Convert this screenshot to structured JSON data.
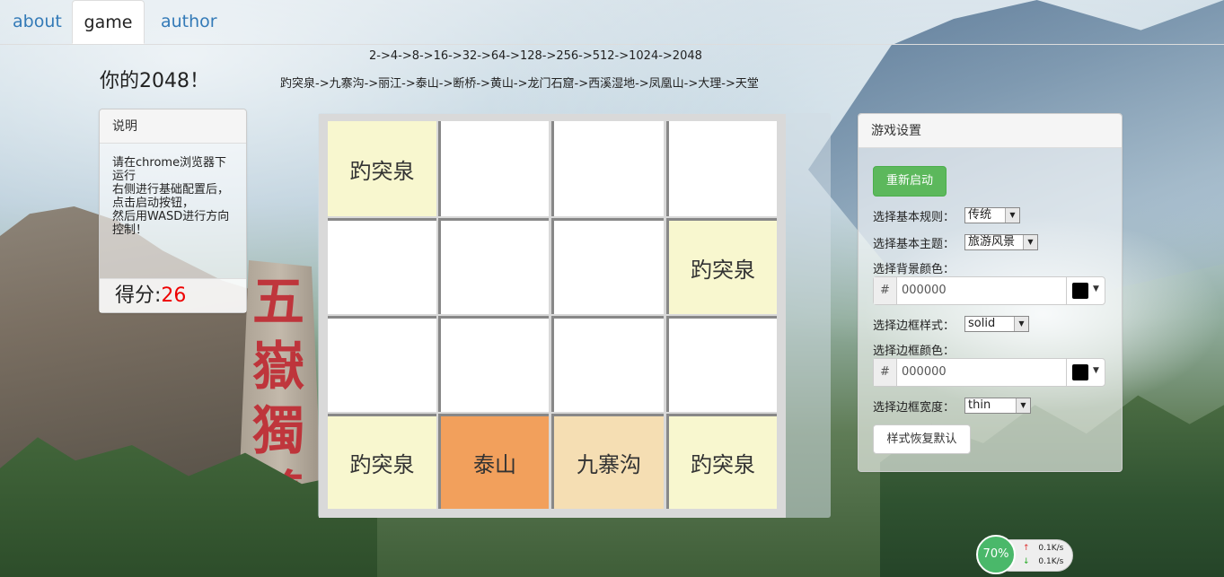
{
  "nav": {
    "tabs": [
      {
        "label": "about"
      },
      {
        "label": "game"
      },
      {
        "label": "author"
      }
    ]
  },
  "header": {
    "title": "你的2048！",
    "sequence_numbers": "2->4->8->16->32->64->128->256->512->1024->2048",
    "sequence_places": "趵突泉->九寨沟->丽江->泰山->断桥->黄山->龙门石窟->西溪湿地->凤凰山->大理->天堂"
  },
  "instructions": {
    "heading": "说明",
    "lines": [
      "请在chrome浏览器下运行",
      "右侧进行基础配置后，",
      "点击启动按钮，",
      "然后用WASD进行方向控制！"
    ]
  },
  "score": {
    "label": "得分:",
    "value": "26"
  },
  "board": {
    "tiles": [
      {
        "label": "趵突泉",
        "color": "#f8f7cf"
      },
      {
        "label": "",
        "color": "#ffffff"
      },
      {
        "label": "",
        "color": "#ffffff"
      },
      {
        "label": "",
        "color": "#ffffff"
      },
      {
        "label": "",
        "color": "#ffffff"
      },
      {
        "label": "",
        "color": "#ffffff"
      },
      {
        "label": "",
        "color": "#ffffff"
      },
      {
        "label": "趵突泉",
        "color": "#f8f7cf"
      },
      {
        "label": "",
        "color": "#ffffff"
      },
      {
        "label": "",
        "color": "#ffffff"
      },
      {
        "label": "",
        "color": "#ffffff"
      },
      {
        "label": "",
        "color": "#ffffff"
      },
      {
        "label": "趵突泉",
        "color": "#f8f7cf"
      },
      {
        "label": "泰山",
        "color": "#f2a05c"
      },
      {
        "label": "九寨沟",
        "color": "#f5deb3"
      },
      {
        "label": "趵突泉",
        "color": "#f8f7cf"
      }
    ]
  },
  "settings": {
    "heading": "游戏设置",
    "restart_label": "重新启动",
    "rule_label": "选择基本规则：",
    "rule_value": "传统",
    "theme_label": "选择基本主题：",
    "theme_value": "旅游风景",
    "bg_color_label": "选择背景颜色：",
    "bg_color_hash": "#",
    "bg_color_value": "000000",
    "border_style_label": "选择边框样式：",
    "border_style_value": "solid",
    "border_color_label": "选择边框颜色：",
    "border_color_hash": "#",
    "border_color_value": "000000",
    "border_width_label": "选择边框宽度：",
    "border_width_value": "thin",
    "reset_label": "样式恢复默认"
  },
  "speed_widget": {
    "percent": "70%",
    "up": "0.1K/s",
    "down": "0.1K/s",
    "up_arrow": "↑",
    "down_arrow": "↓"
  },
  "background_text": "五嶽獨尊"
}
